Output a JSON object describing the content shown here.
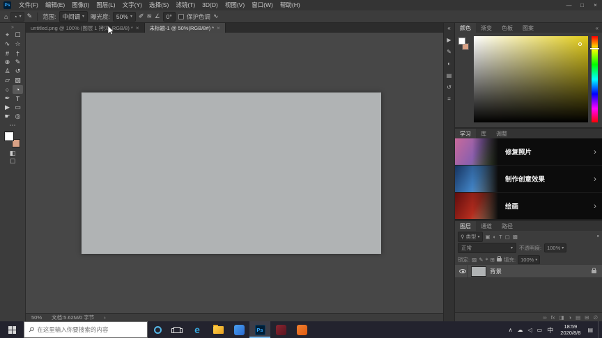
{
  "titlebar": {
    "logo": "Ps",
    "logo_bg": "#001e36",
    "logo_color": "#31a8ff",
    "menus": [
      "文件(F)",
      "编辑(E)",
      "图像(I)",
      "图层(L)",
      "文字(Y)",
      "选择(S)",
      "滤镜(T)",
      "3D(D)",
      "视图(V)",
      "窗口(W)",
      "帮助(H)"
    ],
    "minimize": "—",
    "maximize": "□",
    "close": "×"
  },
  "options_bar": {
    "home_icon": "⌂",
    "tool_icon": "◔",
    "caret": "▾",
    "brush_panel_icon": "✎",
    "range_label": "范围:",
    "range_value": "中间调",
    "exposure_label": "曝光度:",
    "exposure_value": "50%",
    "pressure_icon": "✐",
    "airbrush_icon": "≋",
    "angle_icon": "∠",
    "angle_value": "0°",
    "protect_tones_label": "保护色调",
    "smoothing_icon": "∿"
  },
  "document_tabs": [
    {
      "title": "untitled.png @ 100% (图层 1 拷贝, RGB/8) *",
      "close": "×"
    },
    {
      "title": "未标题-1 @ 50%(RGB/8#) *",
      "close": "×"
    }
  ],
  "toolbar": {
    "grip": "»",
    "tools": [
      {
        "id": "move",
        "glyph": "⌖"
      },
      {
        "id": "marquee",
        "glyph": "☐"
      },
      {
        "id": "lasso",
        "glyph": "∿"
      },
      {
        "id": "magic-wand",
        "glyph": "☆"
      },
      {
        "id": "crop",
        "glyph": "#"
      },
      {
        "id": "eyedropper",
        "glyph": "†"
      },
      {
        "id": "healing-brush",
        "glyph": "⊕"
      },
      {
        "id": "brush",
        "glyph": "✎"
      },
      {
        "id": "clone-stamp",
        "glyph": "♙"
      },
      {
        "id": "history-brush",
        "glyph": "↺"
      },
      {
        "id": "eraser",
        "glyph": "▱"
      },
      {
        "id": "gradient",
        "glyph": "▧"
      },
      {
        "id": "blur",
        "glyph": "○"
      },
      {
        "id": "dodge",
        "glyph": "◔"
      },
      {
        "id": "pen",
        "glyph": "✒"
      },
      {
        "id": "type",
        "glyph": "T"
      },
      {
        "id": "path-selection",
        "glyph": "▶"
      },
      {
        "id": "shape",
        "glyph": "▭"
      },
      {
        "id": "hand",
        "glyph": "☛"
      },
      {
        "id": "zoom",
        "glyph": "◎"
      }
    ],
    "edit_toolbar_icon": "⋯",
    "foreground_color": "#ffffff",
    "background_color": "#d9a185",
    "quick_mask_icon": "◧",
    "screen_mode_icon": "☐"
  },
  "canvas": {
    "color": "#b0b3b4",
    "zoom": "50%",
    "info": "文档:5.62M/0 字节",
    "expand": "›"
  },
  "dock_strip": {
    "collapse_icon": "«",
    "icons": [
      {
        "name": "actions",
        "glyph": "▶"
      },
      {
        "name": "brush-settings",
        "glyph": "✎"
      },
      {
        "name": "adjustments",
        "glyph": "◐"
      },
      {
        "name": "libraries",
        "glyph": "▤"
      },
      {
        "name": "history",
        "glyph": "↺"
      },
      {
        "name": "properties",
        "glyph": "≡"
      }
    ]
  },
  "panels": {
    "color": {
      "tabs": [
        "颜色",
        "渐变",
        "色板",
        "图案"
      ],
      "collapse_icon": "«",
      "picker": [
        "#ffffff",
        "#e2cc1a"
      ],
      "hue": "#e2cc1a"
    },
    "learn": {
      "tabs": [
        "学习",
        "库",
        "调整"
      ],
      "chevron": "›",
      "items": [
        {
          "label": "修复照片",
          "thumb": [
            "#c96a9b",
            "#8a5fae",
            "#5f8a3a"
          ]
        },
        {
          "label": "制作创意效果",
          "thumb": [
            "#16335f",
            "#3f7fc0",
            "#9cc6e8"
          ]
        },
        {
          "label": "绘画",
          "thumb": [
            "#5f0d0d",
            "#b32c1e",
            "#e8b58a"
          ]
        }
      ]
    },
    "layers": {
      "tabs": [
        "图层",
        "通道",
        "路径"
      ],
      "filter": {
        "search_icon": "⚲",
        "type_label": "类型",
        "caret": "▾",
        "icons": [
          {
            "name": "pixel-layers",
            "glyph": "▣"
          },
          {
            "name": "adjustment-layers",
            "glyph": "◐"
          },
          {
            "name": "type-layers",
            "glyph": "T"
          },
          {
            "name": "shape-layers",
            "glyph": "▢"
          },
          {
            "name": "smart-objects",
            "glyph": "▩"
          }
        ],
        "toggle": "●"
      },
      "blend_mode": "正常",
      "opacity_label": "不透明度:",
      "opacity_value": "100%",
      "lock_label": "锁定:",
      "lock_icons": [
        {
          "name": "lock-transparent",
          "glyph": "▨"
        },
        {
          "name": "lock-pixels",
          "glyph": "✎"
        },
        {
          "name": "lock-position",
          "glyph": "⌖"
        },
        {
          "name": "lock-artboard",
          "glyph": "⊞"
        }
      ],
      "fill_label": "填充:",
      "fill_value": "100%",
      "layer": {
        "name": "背景",
        "thumb": "#b0b3b4"
      },
      "bottom_icons": [
        {
          "name": "link-layers",
          "glyph": "∞"
        },
        {
          "name": "layer-effects",
          "glyph": "fx"
        },
        {
          "name": "layer-mask",
          "glyph": "◨"
        },
        {
          "name": "adjustment-layer",
          "glyph": "◑"
        },
        {
          "name": "new-group",
          "glyph": "▤"
        },
        {
          "name": "new-layer",
          "glyph": "⊞"
        },
        {
          "name": "delete-layer",
          "glyph": "∅"
        }
      ]
    }
  },
  "taskbar": {
    "search_placeholder": "在这里输入你要搜索的内容",
    "search_icon": "⚲",
    "apps": [
      {
        "name": "edge",
        "glyph": "e",
        "color": "#38a9e0"
      },
      {
        "name": "file-explorer",
        "colors": [
          "#ffd24a",
          "#e8a020"
        ]
      },
      {
        "name": "chat",
        "colors": [
          "#4aa0f0",
          "#2a6ad0"
        ]
      },
      {
        "name": "photoshop",
        "glyph": "Ps",
        "bg": "#001e36",
        "color": "#31a8ff"
      },
      {
        "name": "app-red",
        "colors": [
          "#8a2530",
          "#5a1520"
        ]
      },
      {
        "name": "app-orange",
        "colors": [
          "#f08030",
          "#e05a10"
        ]
      }
    ],
    "tray": {
      "hidden_icons": "∧",
      "cloud": "☁",
      "volume": "◁",
      "battery": "▭",
      "ime": "中",
      "time": "18:59",
      "date": "2020/8/8",
      "action_center": "▤"
    }
  }
}
